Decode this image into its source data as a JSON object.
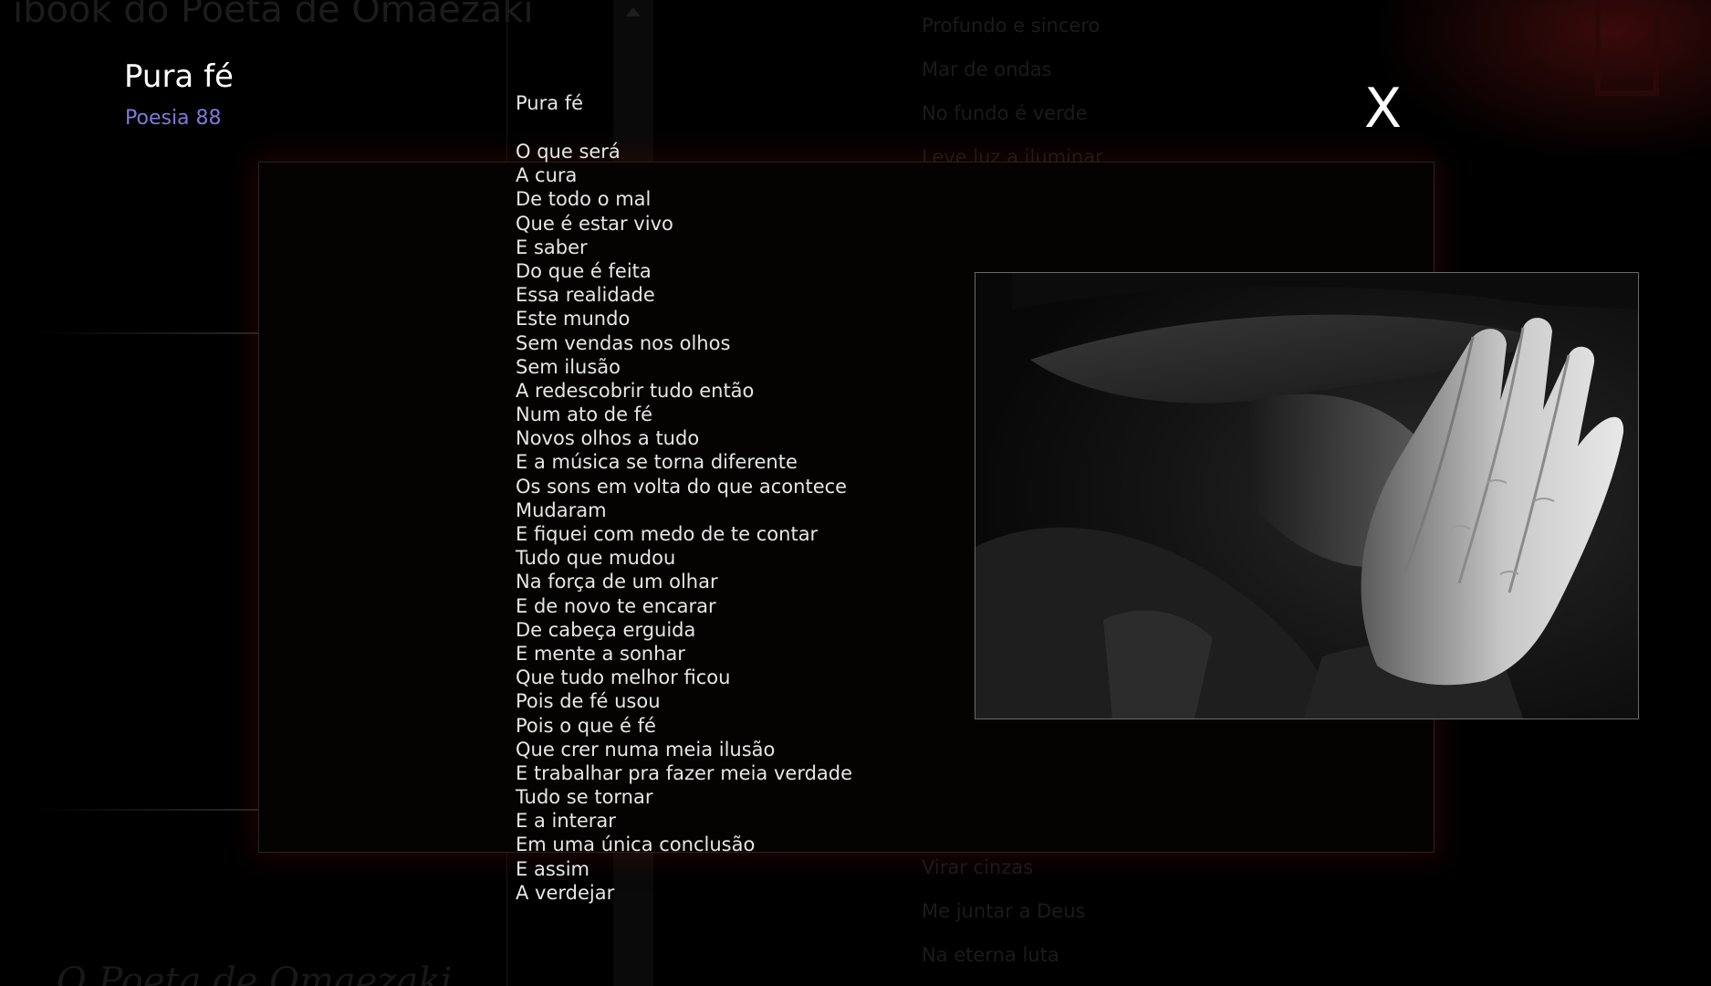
{
  "app": {
    "title": "ibook do Poeta de Omaezaki",
    "author_footer": "O Poeta de Omaezaki"
  },
  "background_list": {
    "top_items": [
      "Profundo e sincero",
      "Mar de ondas",
      "No fundo é verde",
      "Leve luz a iluminar"
    ],
    "bottom_items": [
      "Virar cinzas",
      "Me juntar a Deus",
      "Na eterna luta"
    ]
  },
  "header": {
    "title": "Pura fé",
    "subtitle": "Poesia 88"
  },
  "modal": {
    "close_label": "X",
    "poem_title": "Pura fé",
    "poem_lines": [
      "O que será",
      "A cura",
      "De todo o mal",
      "Que é estar vivo",
      "E saber",
      "Do que é feita",
      "Essa realidade",
      "Este mundo",
      "Sem vendas nos olhos",
      "Sem ilusão",
      "A redescobrir tudo então",
      "Num ato de fé",
      "Novos olhos a tudo",
      "E a música se torna diferente",
      "Os sons em volta do que acontece",
      "Mudaram",
      "E fiquei com medo de te contar",
      "Tudo que mudou",
      "Na força de um olhar",
      "E de novo te encarar",
      "De cabeça erguida",
      "E mente a sonhar",
      "Que tudo melhor ficou",
      "Pois de fé usou",
      "Pois o que é fé",
      "Que crer numa meia ilusão",
      "E trabalhar pra fazer meia verdade",
      "Tudo se tornar",
      "E a interar",
      "Em uma única conclusão",
      "E assim",
      "A verdejar"
    ],
    "photo_icon": "praying-hands-photo"
  },
  "colors": {
    "background": "#000000",
    "title_text": "#ffffff",
    "subtitle_accent": "#7b7bd8",
    "poem_text": "#e6e6e6",
    "panel_glow": "#5a0c0c"
  }
}
